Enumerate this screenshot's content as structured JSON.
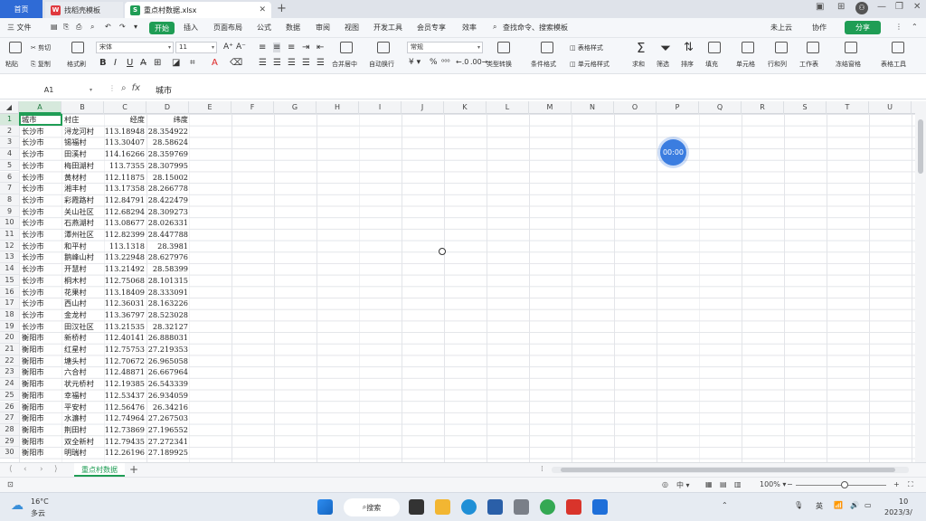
{
  "titlebar": {
    "tabs": [
      {
        "label": "首页"
      },
      {
        "label": "找稻壳模板"
      },
      {
        "label": "重点村数据.xlsx"
      }
    ]
  },
  "menu": {
    "file": "三 文件",
    "items": [
      "开始",
      "插入",
      "页面布局",
      "公式",
      "数据",
      "审阅",
      "视图",
      "开发工具",
      "会员专享",
      "效率"
    ],
    "search_placeholder": "查找命令、搜索模板",
    "cloud": "未上云",
    "collab": "协作",
    "share": "分享"
  },
  "ribbon": {
    "cut": "剪切",
    "copy": "复制",
    "paste": "粘贴",
    "format_painter": "格式刷",
    "font_name": "宋体",
    "font_size": "11",
    "merge": "合并居中",
    "wrap": "自动换行",
    "number_format": "常规",
    "convert": "类型转换",
    "cond_format": "条件格式",
    "table_style": "表格样式",
    "cell_style": "单元格样式",
    "sum": "求和",
    "filter": "筛选",
    "sort": "排序",
    "fill": "填充",
    "cells": "单元格",
    "rows_cols": "行和列",
    "worksheet": "工作表",
    "freeze": "冻结窗格",
    "table_tools": "表格工具"
  },
  "formula_bar": {
    "cell_ref": "A1",
    "fx": "fx",
    "value": "城市"
  },
  "columns": [
    "A",
    "B",
    "C",
    "D",
    "E",
    "F",
    "G",
    "H",
    "I",
    "J",
    "K",
    "L",
    "M",
    "N",
    "O",
    "P",
    "Q",
    "R",
    "S",
    "T",
    "U"
  ],
  "rows": [
    [
      "城市",
      "村庄",
      "经度",
      "纬度"
    ],
    [
      "长沙市",
      "浔龙河村",
      "113.18948",
      "28.354922"
    ],
    [
      "长沙市",
      "锡福村",
      "113.30407",
      "28.58624"
    ],
    [
      "长沙市",
      "田溪村",
      "114.16266",
      "28.359769"
    ],
    [
      "长沙市",
      "梅田湖村",
      "113.7355",
      "28.307995"
    ],
    [
      "长沙市",
      "黄材村",
      "112.11875",
      "28.15002"
    ],
    [
      "长沙市",
      "湘丰村",
      "113.17358",
      "28.266778"
    ],
    [
      "长沙市",
      "彩霞路村",
      "112.84791",
      "28.422479"
    ],
    [
      "长沙市",
      "关山社区",
      "112.68294",
      "28.309273"
    ],
    [
      "长沙市",
      "石燕湖村",
      "113.08677",
      "28.026331"
    ],
    [
      "长沙市",
      "潭州社区",
      "112.82399",
      "28.447788"
    ],
    [
      "长沙市",
      "和平村",
      "113.1318",
      "28.3981"
    ],
    [
      "长沙市",
      "鹅峰山村",
      "113.22948",
      "28.627976"
    ],
    [
      "长沙市",
      "开慧村",
      "113.21492",
      "28.58399"
    ],
    [
      "长沙市",
      "桐木村",
      "112.75068",
      "28.101315"
    ],
    [
      "长沙市",
      "花果村",
      "113.18409",
      "28.333091"
    ],
    [
      "长沙市",
      "西山村",
      "112.36031",
      "28.163226"
    ],
    [
      "长沙市",
      "金龙村",
      "113.36797",
      "28.523028"
    ],
    [
      "长沙市",
      "田汉社区",
      "113.21535",
      "28.32127"
    ],
    [
      "衡阳市",
      "新桥村",
      "112.40141",
      "26.888031"
    ],
    [
      "衡阳市",
      "红星村",
      "112.75753",
      "27.219353"
    ],
    [
      "衡阳市",
      "塘头村",
      "112.70672",
      "26.965058"
    ],
    [
      "衡阳市",
      "六合村",
      "112.48871",
      "26.667964"
    ],
    [
      "衡阳市",
      "状元桥村",
      "112.19385",
      "26.543339"
    ],
    [
      "衡阳市",
      "幸福村",
      "112.53437",
      "26.934059"
    ],
    [
      "衡阳市",
      "平安村",
      "112.56476",
      "26.34216"
    ],
    [
      "衡阳市",
      "水濂村",
      "112.74964",
      "27.267503"
    ],
    [
      "衡阳市",
      "荆田村",
      "112.73869",
      "27.196552"
    ],
    [
      "衡阳市",
      "双全新村",
      "112.79435",
      "27.272341"
    ],
    [
      "衡阳市",
      "明瑞村",
      "112.26196",
      "27.189925"
    ]
  ],
  "timer": "00:00",
  "sheet": {
    "active_tab": "重点村数据",
    "add": "+"
  },
  "status": {
    "zoom": "100%",
    "lang": "中"
  },
  "taskbar": {
    "weather_temp": "16°C",
    "weather_desc": "多云",
    "search": "搜索",
    "ime": "英",
    "time": "10",
    "date": "2023/3/"
  }
}
